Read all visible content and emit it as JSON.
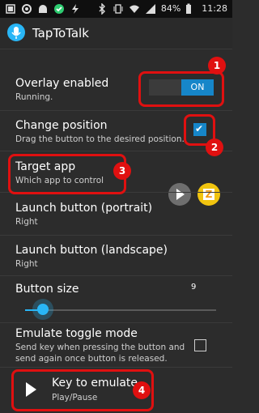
{
  "status": {
    "battery": "84%",
    "time": "11:28",
    "left_icons": [
      "notification-icon",
      "settings-gear-icon",
      "android-icon",
      "checkmark-icon",
      "flash-icon"
    ],
    "right_icons": [
      "bluetooth-icon",
      "vibrate-icon",
      "wifi-icon",
      "signal-icon",
      "battery-icon"
    ]
  },
  "app": {
    "title": "TapToTalk"
  },
  "prefs": {
    "overlay": {
      "title": "Overlay enabled",
      "subtitle": "Running.",
      "toggle_on": "ON"
    },
    "position": {
      "title": "Change position",
      "subtitle": "Drag the button to the desired position."
    },
    "target": {
      "title": "Target app",
      "subtitle": "Which app to control"
    },
    "launch_portrait": {
      "title": "Launch button (portrait)",
      "subtitle": "Right"
    },
    "launch_landscape": {
      "title": "Launch button (landscape)",
      "subtitle": "Right"
    },
    "button_size": {
      "title": "Button size",
      "value": "9",
      "fraction": 0.05
    },
    "emulate": {
      "title": "Emulate toggle mode",
      "subtitle_line1": "Send key when pressing the button and",
      "subtitle_line2": "send again once button is released."
    },
    "key": {
      "title": "Key to emulate",
      "subtitle": "Play/Pause"
    }
  },
  "annotations": {
    "badge1": "1",
    "badge2": "2",
    "badge3": "3",
    "badge4": "4"
  },
  "colors": {
    "accent": "#29b6f6",
    "switch_on": "#1686c9",
    "annotation_red": "#e01010"
  }
}
